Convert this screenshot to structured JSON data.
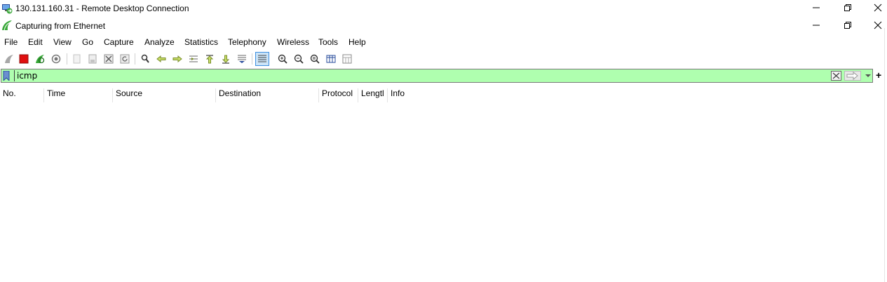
{
  "rdp": {
    "title": "130.131.160.31 - Remote Desktop Connection"
  },
  "app": {
    "title": "Capturing from Ethernet"
  },
  "menu": [
    "File",
    "Edit",
    "View",
    "Go",
    "Capture",
    "Analyze",
    "Statistics",
    "Telephony",
    "Wireless",
    "Tools",
    "Help"
  ],
  "toolbar": {
    "icons": [
      "shark-fin-start-icon",
      "stop-capture-icon",
      "restart-capture-icon",
      "capture-options-icon",
      "open-file-icon",
      "save-file-icon",
      "close-file-icon",
      "reload-file-icon",
      "find-packet-icon",
      "go-back-icon",
      "go-forward-icon",
      "go-to-packet-icon",
      "first-packet-icon",
      "last-packet-icon",
      "auto-scroll-icon",
      "colorize-icon",
      "zoom-in-icon",
      "zoom-out-icon",
      "normal-size-icon",
      "resize-columns-icon",
      "layout-icon"
    ]
  },
  "filter": {
    "value": "icmp",
    "bg_color": "#afffaf"
  },
  "columns": [
    "No.",
    "Time",
    "Source",
    "Destination",
    "Protocol",
    "Lengtl",
    "Info"
  ],
  "colors": {
    "stop": "#e01010",
    "green": "#3aa83a",
    "active_bg": "#cce4f7"
  }
}
